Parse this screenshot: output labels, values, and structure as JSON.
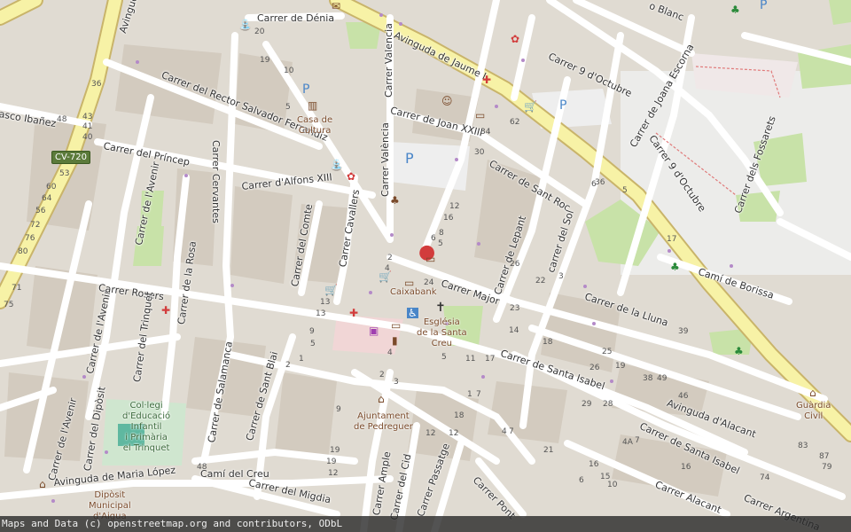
{
  "map": {
    "attribution": "Maps and Data (c) openstreetmap.org and contributors, ODbL",
    "road_badge": "CV-720",
    "streets": {
      "denia": "Carrer de Dénia",
      "jaume": "Avinguda de Jaume I",
      "avinguda_nw": "Avinguda",
      "rector": "Carrer del Rector Salvador Ferrandiz",
      "ibanez": "asco Ibañez",
      "princep": "Carrer del Príncep",
      "joan": "Carrer de Joan XXIII",
      "valencia_top": "Carrer Valencia",
      "valencia": "Carrer València",
      "alfons": "Carrer d'Alfons XIII",
      "cervantes": "Carrer Cervantes",
      "avenir_n": "Carrer de l'Avenir",
      "avenir_mid": "Carrer de l'Avenir",
      "avenir_s": "Carrer de l'Avenir",
      "comte": "Carrer del Comte",
      "cavallers": "Carrer Cavallers",
      "rosa": "Carrer de la Rosa",
      "rosers": "Carrer Rosers",
      "trinquet": "Carrer del Trinquet",
      "major": "Carrer Major",
      "santroc": "Carrer de Sant Roc",
      "lepant": "Carrer de Lepant",
      "sol": "carrer del Sol",
      "octubre1": "Carrer 9 d'Octubre",
      "octubre2": "Carrer 9 d'Octubre",
      "escorna": "Carrer de Joana Escorna",
      "fossarets": "Carrer dels Fossarets",
      "blanc": "o Blanc",
      "borissa": "Camí de Borissa",
      "lluna": "Carrer de la Lluna",
      "isabel1": "Carrer de Santa Isabel",
      "isabel2": "Carrer de Santa Isabel",
      "alacant_av": "Avinguda d'Alacant",
      "alacant": "Carrer Alacant",
      "argentina": "Carrer Argentina",
      "salamanca": "Carrer de Salamanca",
      "santblai": "Carrer de Sant Blai",
      "diposit": "Carrer del Dipòsit",
      "maria": "Avinguda de Maria López",
      "migdia": "Carrer del Migdia",
      "creu": "Camí del Creu",
      "ample": "Carrer Ample",
      "cid": "Carrer del Cid",
      "passatge": "Carrer Passatge",
      "pont": "Carrer Pont"
    },
    "pois": {
      "cultura": "Casa de\nCultura",
      "caixabank": "Caixabank",
      "esglesia": "Església\nde la Santa\nCreu",
      "ajuntament": "Ajuntament\nde Pedreguer",
      "collegi": "Col·legi\nd'Educació\nInfantil\ni Primària\nel Trinquet",
      "diposit": "Dipòsit\nMunicipal\nd'Aigua",
      "guardia": "Guàrdia\nCivil"
    },
    "house_numbers": [
      "20",
      "19",
      "10",
      "5",
      "36",
      "48",
      "43",
      "41",
      "40",
      "53",
      "60",
      "64",
      "56",
      "72",
      "76",
      "80",
      "71",
      "75",
      "34",
      "62",
      "30",
      "12",
      "16",
      "8",
      "6",
      "5",
      "2",
      "4",
      "24",
      "26",
      "22",
      "3",
      "6",
      "5",
      "23",
      "13",
      "9",
      "5",
      "4",
      "2",
      "18",
      "17",
      "11",
      "5",
      "25",
      "39",
      "26",
      "19",
      "38",
      "49",
      "46",
      "29",
      "28",
      "4",
      "7",
      "1",
      "7",
      "18",
      "12",
      "21",
      "16",
      "15",
      "6",
      "10",
      "4A",
      "7",
      "83",
      "87",
      "79",
      "74",
      "16",
      "2",
      "1",
      "3",
      "12",
      "19",
      "48",
      "36",
      "17",
      "14",
      "13",
      "9",
      "19",
      "12"
    ]
  }
}
